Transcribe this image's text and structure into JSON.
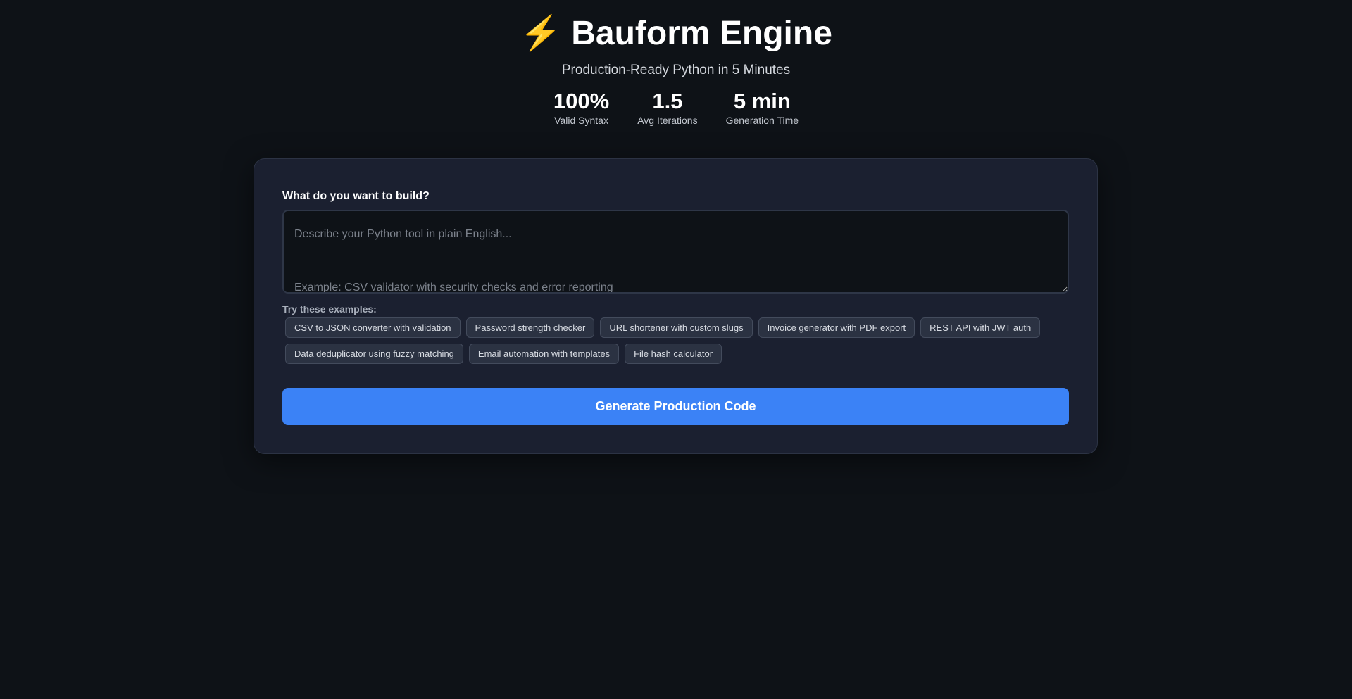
{
  "header": {
    "icon": "lightning-bolt-icon",
    "icon_glyph": "⚡",
    "title": "Bauform Engine",
    "subtitle": "Production-Ready Python in 5 Minutes"
  },
  "stats": [
    {
      "value": "100%",
      "label": "Valid Syntax"
    },
    {
      "value": "1.5",
      "label": "Avg Iterations"
    },
    {
      "value": "5 min",
      "label": "Generation Time"
    }
  ],
  "form": {
    "label": "What do you want to build?",
    "placeholder": "Describe your Python tool in plain English...\n\nExample: CSV validator with security checks and error reporting",
    "value": "",
    "examples_label": "Try these examples:",
    "examples": [
      "CSV to JSON converter with validation",
      "Password strength checker",
      "URL shortener with custom slugs",
      "Invoice generator with PDF export",
      "REST API with JWT auth",
      "Data deduplicator using fuzzy matching",
      "Email automation with templates",
      "File hash calculator"
    ],
    "submit_label": "Generate Production Code"
  },
  "colors": {
    "accent": "#3b82f6",
    "background": "#0e1217",
    "card": "#1b2030"
  }
}
